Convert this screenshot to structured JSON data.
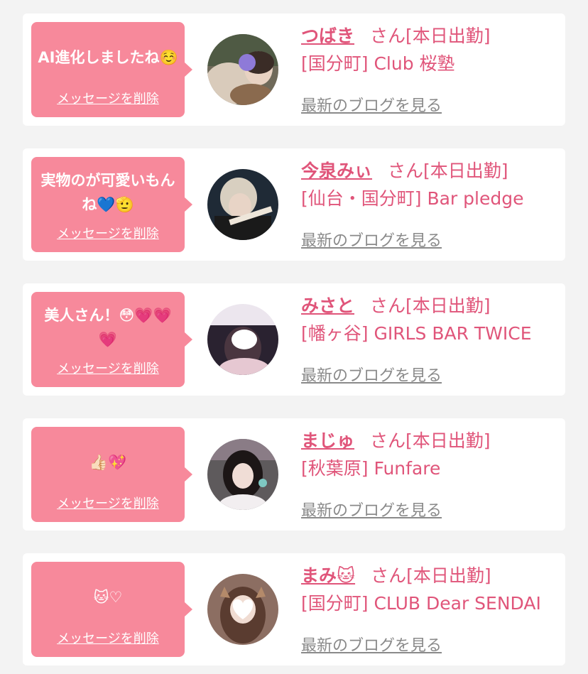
{
  "cards": [
    {
      "message": "AI進化しましたね☺️",
      "delete_label": "メッセージを削除",
      "cast_name": "つばき",
      "suffix": "さん[本日出勤]",
      "shop": "[国分町] Club 桜塾",
      "blog_link": "最新のブログを見る"
    },
    {
      "message": "実物のが可愛いもんね💙🫡",
      "delete_label": "メッセージを削除",
      "cast_name": "今泉みぃ",
      "suffix": "さん[本日出勤]",
      "shop": "[仙台・国分町] Bar pledge",
      "blog_link": "最新のブログを見る"
    },
    {
      "message": "美人さん！😳💗💗💗",
      "delete_label": "メッセージを削除",
      "cast_name": "みさと",
      "suffix": "さん[本日出勤]",
      "shop": "[幡ヶ谷] GIRLS BAR TWICE",
      "blog_link": "最新のブログを見る"
    },
    {
      "message": "👍🏻💖",
      "delete_label": "メッセージを削除",
      "cast_name": "まじゅ",
      "suffix": "さん[本日出勤]",
      "shop": "[秋葉原] Funfare",
      "blog_link": "最新のブログを見る"
    },
    {
      "message": "🐱♡",
      "delete_label": "メッセージを削除",
      "cast_name": "まみ🐱",
      "suffix": "さん[本日出勤]",
      "shop": "[国分町] CLUB Dear SENDAI",
      "blog_link": "最新のブログを見る"
    }
  ],
  "colors": {
    "bubble": "#f7899b",
    "accent": "#e0557a",
    "link_gray": "#8a8a8a",
    "background": "#f3f3f3"
  }
}
